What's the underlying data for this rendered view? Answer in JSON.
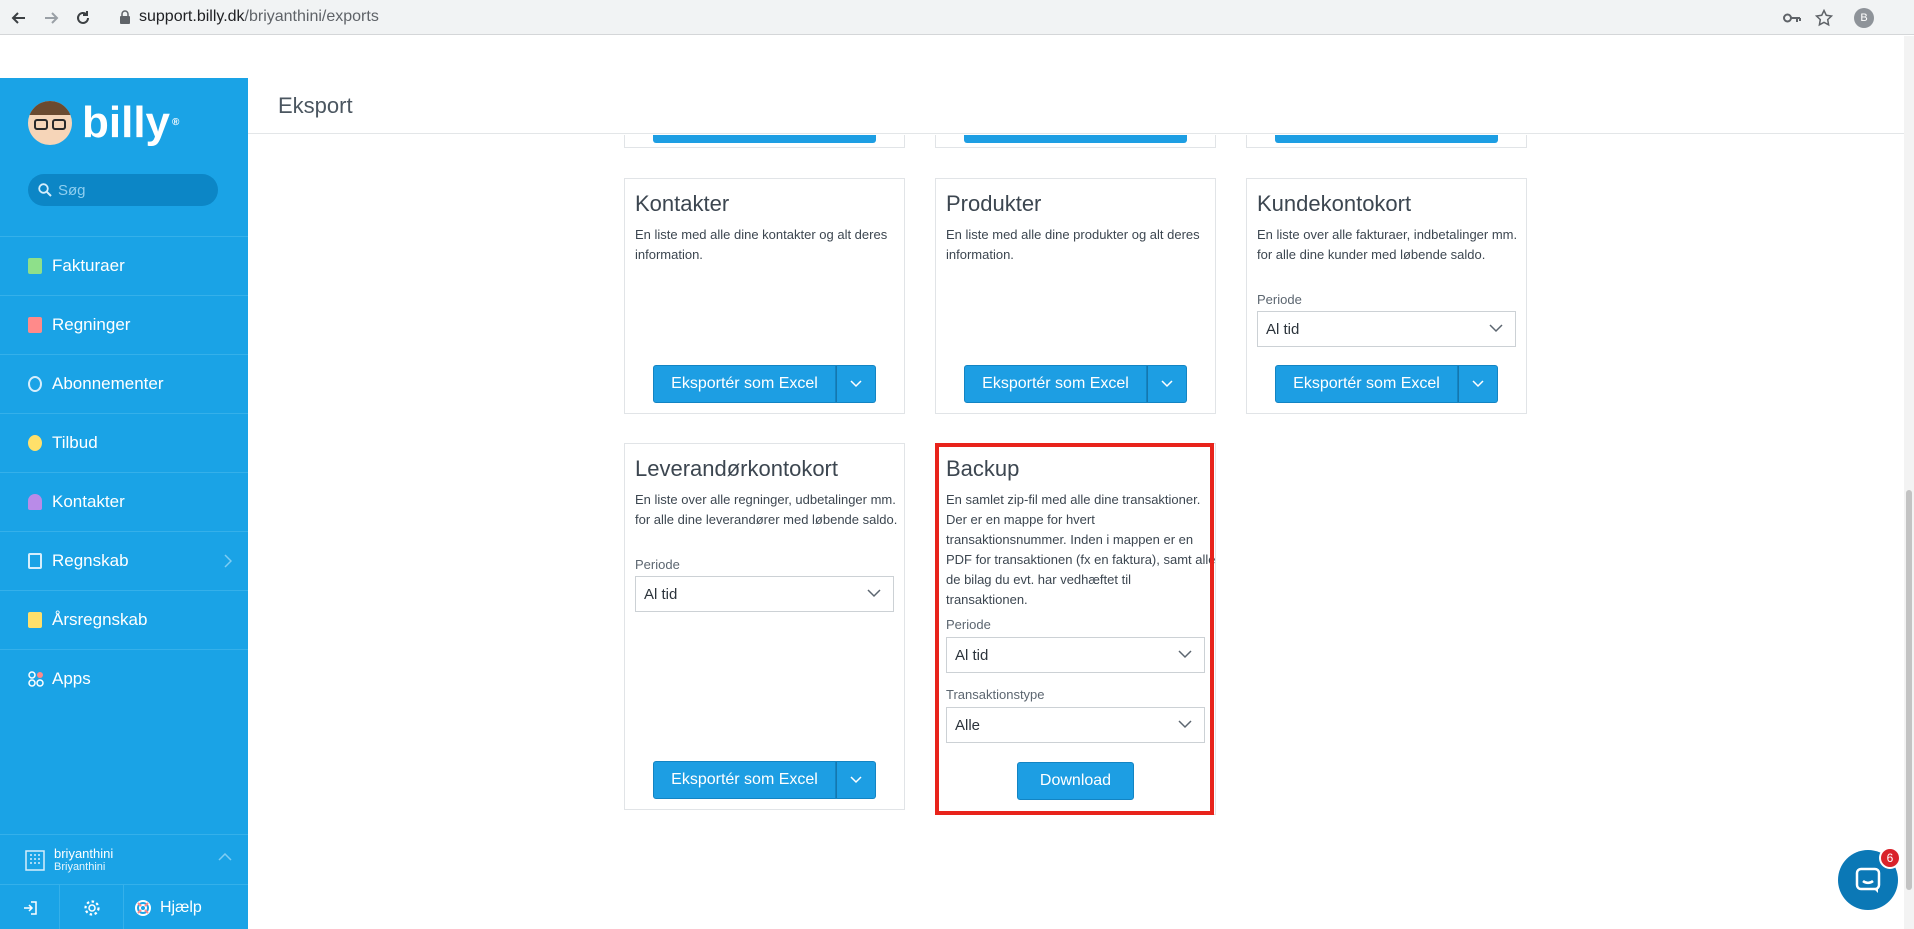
{
  "browser": {
    "url_host": "support.billy.dk",
    "url_path": "/briyanthini/exports",
    "profile_initial": "B"
  },
  "sidebar": {
    "logo_text": "billy",
    "logo_mark": "®",
    "search_placeholder": "Søg",
    "items": [
      {
        "label": "Fakturaer",
        "icon": "invoice-icon",
        "color": "#8ee08a"
      },
      {
        "label": "Regninger",
        "icon": "bill-icon",
        "color": "#ff8a8a"
      },
      {
        "label": "Abonnementer",
        "icon": "subscription-icon",
        "color": "#d6eefc"
      },
      {
        "label": "Tilbud",
        "icon": "quote-icon",
        "color": "#ffe06a"
      },
      {
        "label": "Kontakter",
        "icon": "contacts-icon",
        "color": "#b98be8"
      },
      {
        "label": "Regnskab",
        "icon": "accounting-icon",
        "color": "#d6eefc"
      },
      {
        "label": "Årsregnskab",
        "icon": "annual-report-icon",
        "color": "#ffe06a"
      },
      {
        "label": "Apps",
        "icon": "apps-icon",
        "color": "#ffffff"
      }
    ],
    "org_name": "briyanthini",
    "org_sub": "Briyanthini",
    "help_label": "Hjælp"
  },
  "header": {
    "title": "Eksport"
  },
  "cards": {
    "kontakter": {
      "title": "Kontakter",
      "desc": "En liste med alle dine kontakter og alt deres information.",
      "button": "Eksportér som Excel"
    },
    "produkter": {
      "title": "Produkter",
      "desc": "En liste med alle dine produkter og alt deres information.",
      "button": "Eksportér som Excel"
    },
    "kundekontokort": {
      "title": "Kundekontokort",
      "desc": "En liste over alle fakturaer, indbetalinger mm. for alle dine kunder med løbende saldo.",
      "period_label": "Periode",
      "period_value": "Al tid",
      "button": "Eksportér som Excel"
    },
    "leverandorkontokort": {
      "title": "Leverandørkontokort",
      "desc": "En liste over alle regninger, udbetalinger mm. for alle dine leverandører med løbende saldo.",
      "period_label": "Periode",
      "period_value": "Al tid",
      "button": "Eksportér som Excel"
    },
    "backup": {
      "title": "Backup",
      "desc": "En samlet zip-fil med alle dine transaktioner. Der er en mappe for hvert transaktionsnummer. Inden i mappen er en PDF for transaktionen (fx en faktura), samt alle de bilag du evt. har vedhæftet til transaktionen.",
      "period_label": "Periode",
      "period_value": "Al tid",
      "type_label": "Transaktionstype",
      "type_value": "Alle",
      "button": "Download"
    }
  },
  "chat": {
    "badge_count": "6"
  },
  "colors": {
    "sidebar": "#1aa3e6",
    "primary_button": "#1d9ee3",
    "highlight": "#e8231b"
  }
}
